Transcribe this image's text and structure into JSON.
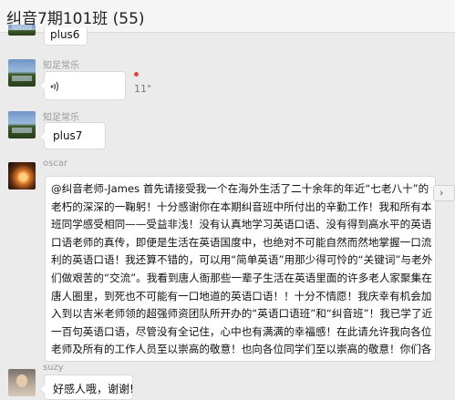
{
  "header": {
    "title": "纠音7期101班 (55)"
  },
  "messages": [
    {
      "type": "text",
      "text": "plus6"
    },
    {
      "type": "voice",
      "sender": "知足常乐",
      "duration": "11\"",
      "unread": true,
      "icon": "voice-wave-icon"
    },
    {
      "type": "text",
      "sender": "知足常乐",
      "text": "plus7"
    },
    {
      "type": "text",
      "sender": "oscar",
      "text": "@纠音老师-James 首先请接受我一个在海外生活了二十余年的年近“七老八十”的老朽的深深的一鞠躬！十分感谢你在本期纠音班中所付出的辛勤工作！我和所有本班同学感受相同——受益非浅！没有认真地学习英语口语、没有得到高水平的英语口语老师的真传，即便是生活在英语国度中，也绝对不可能自然而然地掌握一口流利的英语口语！我还算不错的，可以用“简单英语”用那少得可怜的“关键词”与老外们做艰苦的“交流”。我看到唐人衙那些一辈子生活在英语里面的许多老人家聚集在唐人圈里，到死也不可能有一口地道的英语口语！！十分不情愿！我庆幸有机会加入到以吉米老师领的超强师资团队所开办的“英语口语班”和“纠音班”！我已学了近一百句英语口语，尽管没有全记住，心中也有满满的幸福感！在此请允许我向各位老师及所有的工作人员至以崇高的敬意！也向各位同学们至以崇高的敬意！你们各位的芳名与美语将永远驻存在我的脑海里！下期学习班再见！Oscar"
    },
    {
      "type": "text",
      "sender": "suzy",
      "text": "好感人哦，谢谢!"
    }
  ]
}
